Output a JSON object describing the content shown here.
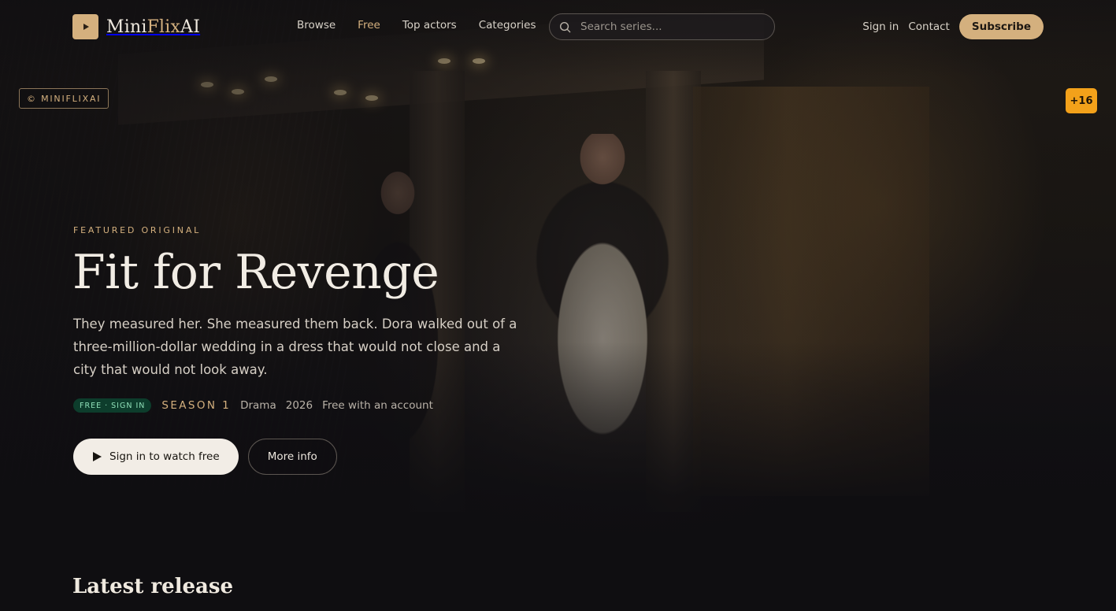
{
  "brand": {
    "name_part1": "Mini",
    "name_part2": "Flix",
    "name_part3": "AI",
    "accent_color": "#d4b07e",
    "logo_icon": "play-icon"
  },
  "nav": {
    "items": [
      {
        "label": "Browse",
        "active": false
      },
      {
        "label": "Free",
        "active": true
      },
      {
        "label": "Top actors",
        "active": false
      },
      {
        "label": "Categories",
        "active": false
      }
    ]
  },
  "search": {
    "placeholder": "Search series...",
    "value": "",
    "icon": "search-icon"
  },
  "header_actions": {
    "sign_in": "Sign in",
    "contact": "Contact",
    "subscribe": "Subscribe"
  },
  "overlays": {
    "watermark": "© MINIFLIXAI",
    "age_rating": "+16",
    "age_rating_color": "#f3a11a"
  },
  "hero": {
    "eyebrow": "FEATURED ORIGINAL",
    "title": "Fit for Revenge",
    "synopsis": "They measured her. She measured them back. Dora walked out of a three-million-dollar wedding in a dress that would not close and a city that would not look away.",
    "badge": "FREE · SIGN IN",
    "badge_color": "#0d3d2c",
    "season": "SEASON 1",
    "genre": "Drama",
    "year": "2026",
    "availability": "Free with an account",
    "primary_cta": "Sign in to watch free",
    "secondary_cta": "More info"
  },
  "sections": {
    "latest_title": "Latest release"
  }
}
